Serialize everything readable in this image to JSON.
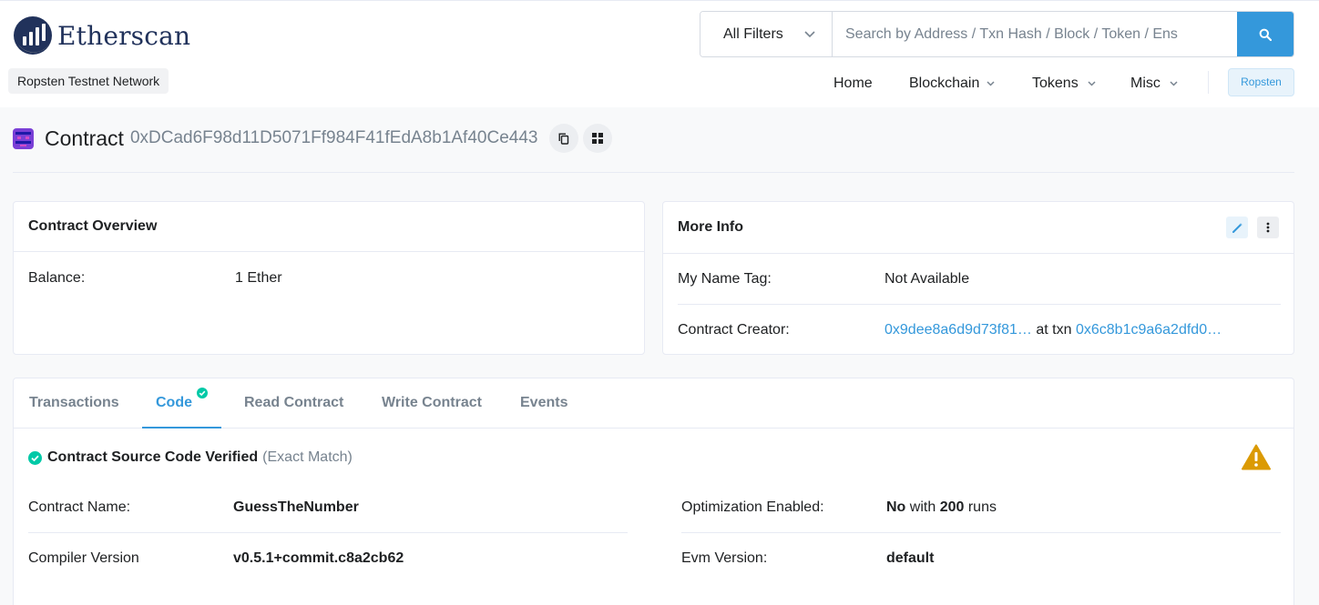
{
  "header": {
    "brand": "Etherscan",
    "network_badge": "Ropsten Testnet Network",
    "filter_label": "All Filters",
    "search_placeholder": "Search by Address / Txn Hash / Block / Token / Ens",
    "nav": [
      "Home",
      "Blockchain",
      "Tokens",
      "Misc"
    ],
    "network_button": "Ropsten"
  },
  "title": {
    "label": "Contract",
    "address": "0xDCad6F98d11D5071Ff984F41fEdA8b1Af40Ce443"
  },
  "overview": {
    "heading": "Contract Overview",
    "balance_label": "Balance:",
    "balance_value": "1 Ether"
  },
  "more_info": {
    "heading": "More Info",
    "name_tag_label": "My Name Tag:",
    "name_tag_value": "Not Available",
    "creator_label": "Contract Creator:",
    "creator_address": "0x9dee8a6d9d73f81…",
    "creator_at_txn": "at txn",
    "creator_txn": "0x6c8b1c9a6a2dfd0…"
  },
  "tabs": {
    "items": [
      "Transactions",
      "Code",
      "Read Contract",
      "Write Contract",
      "Events"
    ],
    "active": "Code"
  },
  "code": {
    "verified_title": "Contract Source Code Verified",
    "verified_note": "(Exact Match)",
    "contract_name_label": "Contract Name:",
    "contract_name_value": "GuessTheNumber",
    "compiler_label": "Compiler Version",
    "compiler_value": "v0.5.1+commit.c8a2cb62",
    "optimization_label": "Optimization Enabled:",
    "optimization_flag": "No",
    "optimization_with": "with",
    "optimization_runs": "200",
    "optimization_runs_unit": "runs",
    "evm_label": "Evm Version:",
    "evm_value": "default"
  },
  "colors": {
    "accent": "#3498db",
    "success": "#00c9a7",
    "warning": "#db9a04",
    "brand_dark": "#21325b"
  }
}
